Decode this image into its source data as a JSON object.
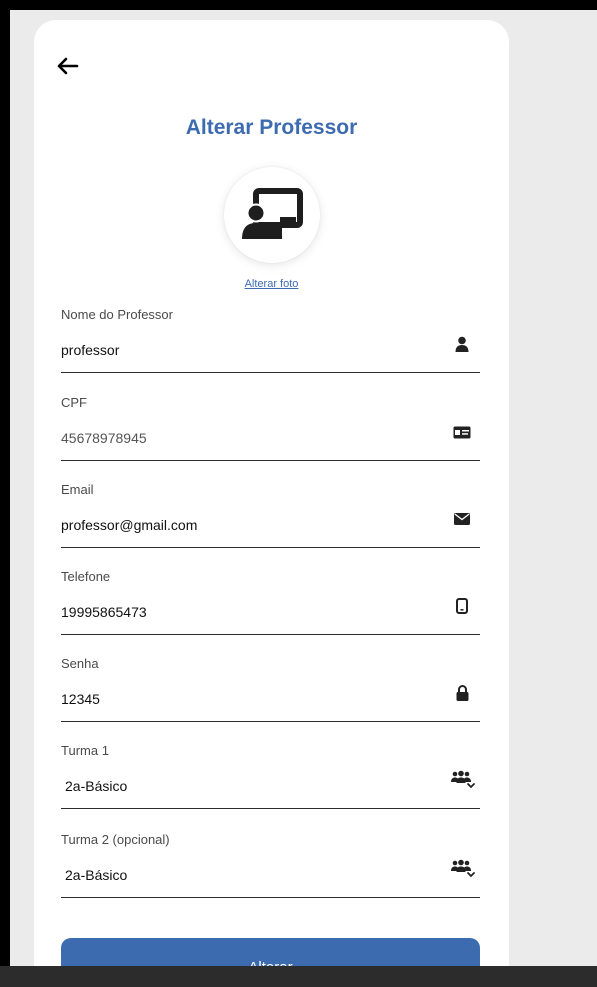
{
  "header": {
    "title": "Alterar Professor"
  },
  "avatar": {
    "icon": "teacher-board-icon",
    "change_photo_label": "Alterar foto"
  },
  "fields": [
    {
      "label": "Nome do Professor",
      "value": "professor",
      "icon": "user-icon"
    },
    {
      "label": "CPF",
      "value": "45678978945",
      "icon": "id-card-icon"
    },
    {
      "label": "Email",
      "value": "professor@gmail.com",
      "icon": "envelope-icon"
    },
    {
      "label": "Telefone",
      "value": "19995865473",
      "icon": "mobile-icon"
    },
    {
      "label": "Senha",
      "value": "12345",
      "icon": "lock-icon"
    },
    {
      "label": "Turma 1",
      "value": "2a-Básico",
      "icon": "users-dropdown-icon"
    },
    {
      "label": "Turma 2 (opcional)",
      "value": "2a-Básico",
      "icon": "users-dropdown-icon"
    }
  ],
  "submit": {
    "label": "Alterar"
  },
  "colors": {
    "accent": "#3d6bb0",
    "background": "#ebebeb",
    "card": "#ffffff"
  }
}
